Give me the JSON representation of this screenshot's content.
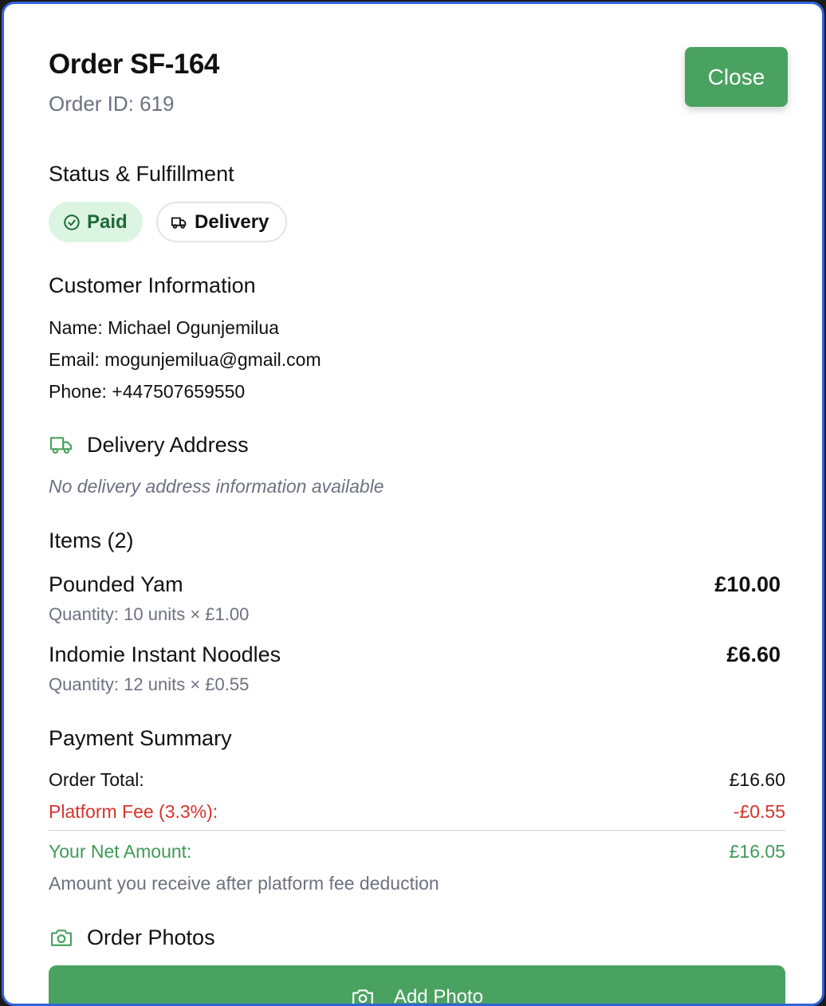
{
  "header": {
    "title": "Order SF-164",
    "order_id": "Order ID: 619",
    "close_label": "Close"
  },
  "status": {
    "section_title": "Status & Fulfillment",
    "paid_label": "Paid",
    "delivery_label": "Delivery"
  },
  "customer": {
    "section_title": "Customer Information",
    "name_key": "Name:",
    "name_value": "Michael Ogunjemilua",
    "email_key": "Email:",
    "email_value": "mogunjemilua@gmail.com",
    "phone_key": "Phone:",
    "phone_value": "+447507659550"
  },
  "address": {
    "section_title": "Delivery Address",
    "empty_text": "No delivery address information available"
  },
  "items": {
    "section_title": "Items (2)",
    "list": [
      {
        "name": "Pounded Yam",
        "quantity": "Quantity: 10 units × £1.00",
        "price": "£10.00"
      },
      {
        "name": "Indomie Instant Noodles",
        "quantity": "Quantity: 12 units × £0.55",
        "price": "£6.60"
      }
    ]
  },
  "payment": {
    "section_title": "Payment Summary",
    "total_label": "Order Total:",
    "total_value": "£16.60",
    "fee_label": "Platform Fee (3.3%):",
    "fee_value": "-£0.55",
    "net_label": "Your Net Amount:",
    "net_value": "£16.05",
    "note": "Amount you receive after platform fee deduction"
  },
  "photos": {
    "section_title": "Order Photos",
    "add_label": "Add Photo"
  },
  "colors": {
    "accent_green": "#4aa260",
    "fee_red": "#d6342c",
    "border_blue": "#2f64d6"
  }
}
